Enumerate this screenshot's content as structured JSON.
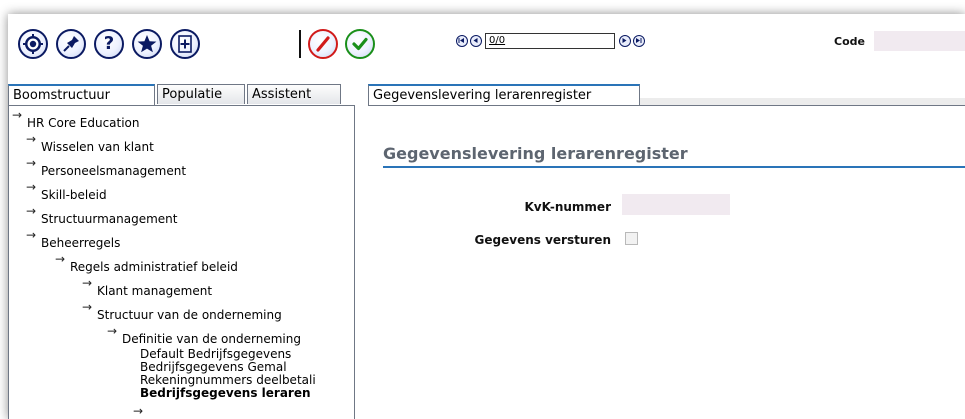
{
  "toolbar": {
    "icons": [
      {
        "name": "settings-icon"
      },
      {
        "name": "pin-icon"
      },
      {
        "name": "help-icon"
      },
      {
        "name": "favorite-star-icon"
      },
      {
        "name": "add-plus-icon"
      },
      {
        "name": "cancel-slash-icon"
      },
      {
        "name": "confirm-check-icon"
      }
    ],
    "pager_value": "0/0",
    "code_label": "Code",
    "code_value": ""
  },
  "left_tabs": [
    "Boomstructuur",
    "Populatie",
    "Assistent"
  ],
  "right_tab": "Gegevenslevering lerarenregister",
  "tree": {
    "root": "HR Core Education",
    "level1": [
      "Wisselen van klant",
      "Personeelsmanagement",
      "Skill-beleid",
      "Structuurmanagement",
      "Beheerregels"
    ],
    "level2": [
      "Regels administratief beleid"
    ],
    "level3": [
      "Klant management",
      "Structuur van de onderneming"
    ],
    "level4": [
      "Definitie van de onderneming"
    ],
    "leaves": [
      "Default Bedrijfsgegevens",
      "Bedrijfsgegevens Gemal",
      "Rekeningnummers deelbetali",
      "Bedrijfsgegevens leraren"
    ],
    "arrow": "→"
  },
  "content": {
    "title": "Gegevenslevering lerarenregister",
    "kvk_label": "KvK-nummer",
    "kvk_value": "",
    "send_label": "Gegevens versturen",
    "send_checked": false
  },
  "colors": {
    "icon_navy": "#0b1a62",
    "cancel_red": "#d11a1a",
    "confirm_green": "#1a8f1a",
    "accent_blue": "#2a74b8",
    "title_gray": "#5d6570",
    "input_pink": "#f1eaf0"
  }
}
